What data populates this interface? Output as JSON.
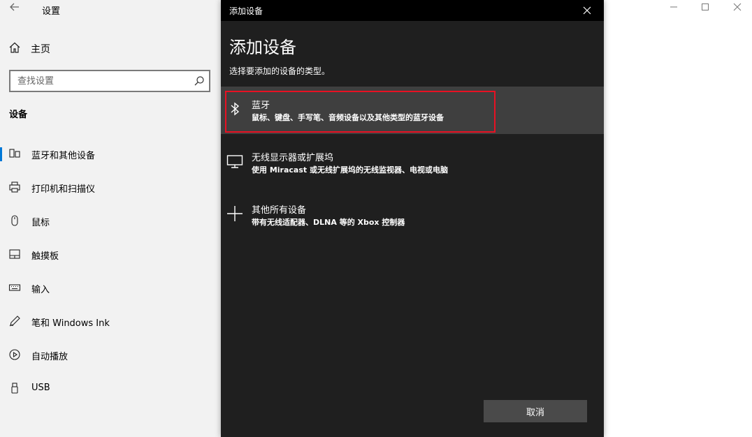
{
  "settings": {
    "title": "设置",
    "home_label": "主页",
    "search_placeholder": "查找设置",
    "section_title": "设备",
    "nav": [
      {
        "label": "蓝牙和其他设备",
        "icon": "bluetooth-devices-icon",
        "selected": true
      },
      {
        "label": "打印机和扫描仪",
        "icon": "printer-icon"
      },
      {
        "label": "鼠标",
        "icon": "mouse-icon"
      },
      {
        "label": "触摸板",
        "icon": "touchpad-icon"
      },
      {
        "label": "输入",
        "icon": "keyboard-icon"
      },
      {
        "label": "笔和 Windows Ink",
        "icon": "pen-icon"
      },
      {
        "label": "自动播放",
        "icon": "autoplay-icon"
      },
      {
        "label": "USB",
        "icon": "usb-icon"
      }
    ]
  },
  "dialog": {
    "window_title": "添加设备",
    "heading": "添加设备",
    "subtitle": "选择要添加的设备的类型。",
    "options": [
      {
        "title": "蓝牙",
        "description": "鼠标、键盘、手写笔、音频设备以及其他类型的蓝牙设备",
        "icon": "bluetooth-icon",
        "highlighted": true
      },
      {
        "title": "无线显示器或扩展坞",
        "description": "使用 Miracast 或无线扩展坞的无线监视器、电视或电脑",
        "icon": "monitor-icon"
      },
      {
        "title": "其他所有设备",
        "description": "带有无线适配器、DLNA 等的 Xbox 控制器",
        "icon": "plus-icon"
      }
    ],
    "cancel_label": "取消"
  },
  "colors": {
    "accent": "#0078d7",
    "dialog_bg": "#1f1f1f",
    "highlight_frame": "#e81123"
  }
}
